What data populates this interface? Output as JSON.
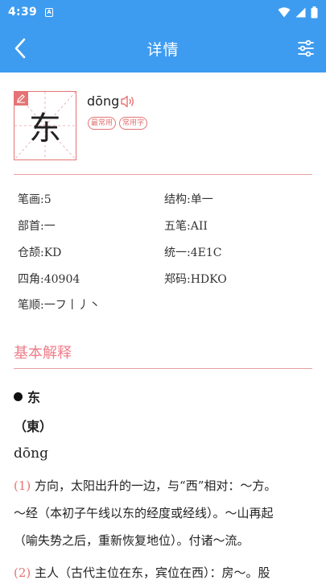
{
  "status": {
    "time": "4:39",
    "notif_letter": "A"
  },
  "appbar": {
    "title": "详情"
  },
  "character": {
    "glyph": "东",
    "pinyin": "dōng",
    "badges": [
      "最常用",
      "常用字"
    ]
  },
  "info": {
    "strokes": "笔画:5",
    "structure": "结构:单一",
    "radical": "部首:一",
    "wubi": "五笔:AII",
    "cangjie": "仓颉:KD",
    "unicode": "统一:4E1C",
    "sijiao": "四角:40904",
    "zhengma": "郑码:HDKO",
    "stroke_order": "笔顺:一フ丨丿丶"
  },
  "basic": {
    "title": "基本解释",
    "head": "东",
    "traditional": "（東）",
    "pinyin": "dōng",
    "def1_num": "(1)",
    "def1_line1": " 方向，太阳出升的一边，与“西”相对：～方。",
    "def1_line2": "～经（本初子午线以东的经度或经线）。～山再起",
    "def1_line3": "（喻失势之后，重新恢复地位）。付诸～流。",
    "def2_num": "(2)",
    "def2_line1": " 主人（古代主位在东，宾位在西）：房～。股"
  },
  "colors": {
    "primary": "#3d9cf0",
    "accent": "#e57373",
    "section": "#ef7d8a"
  },
  "icons": {
    "back": "chevron-left-icon",
    "filter": "sliders-icon",
    "edit": "pencil-icon",
    "sound": "speaker-icon"
  }
}
